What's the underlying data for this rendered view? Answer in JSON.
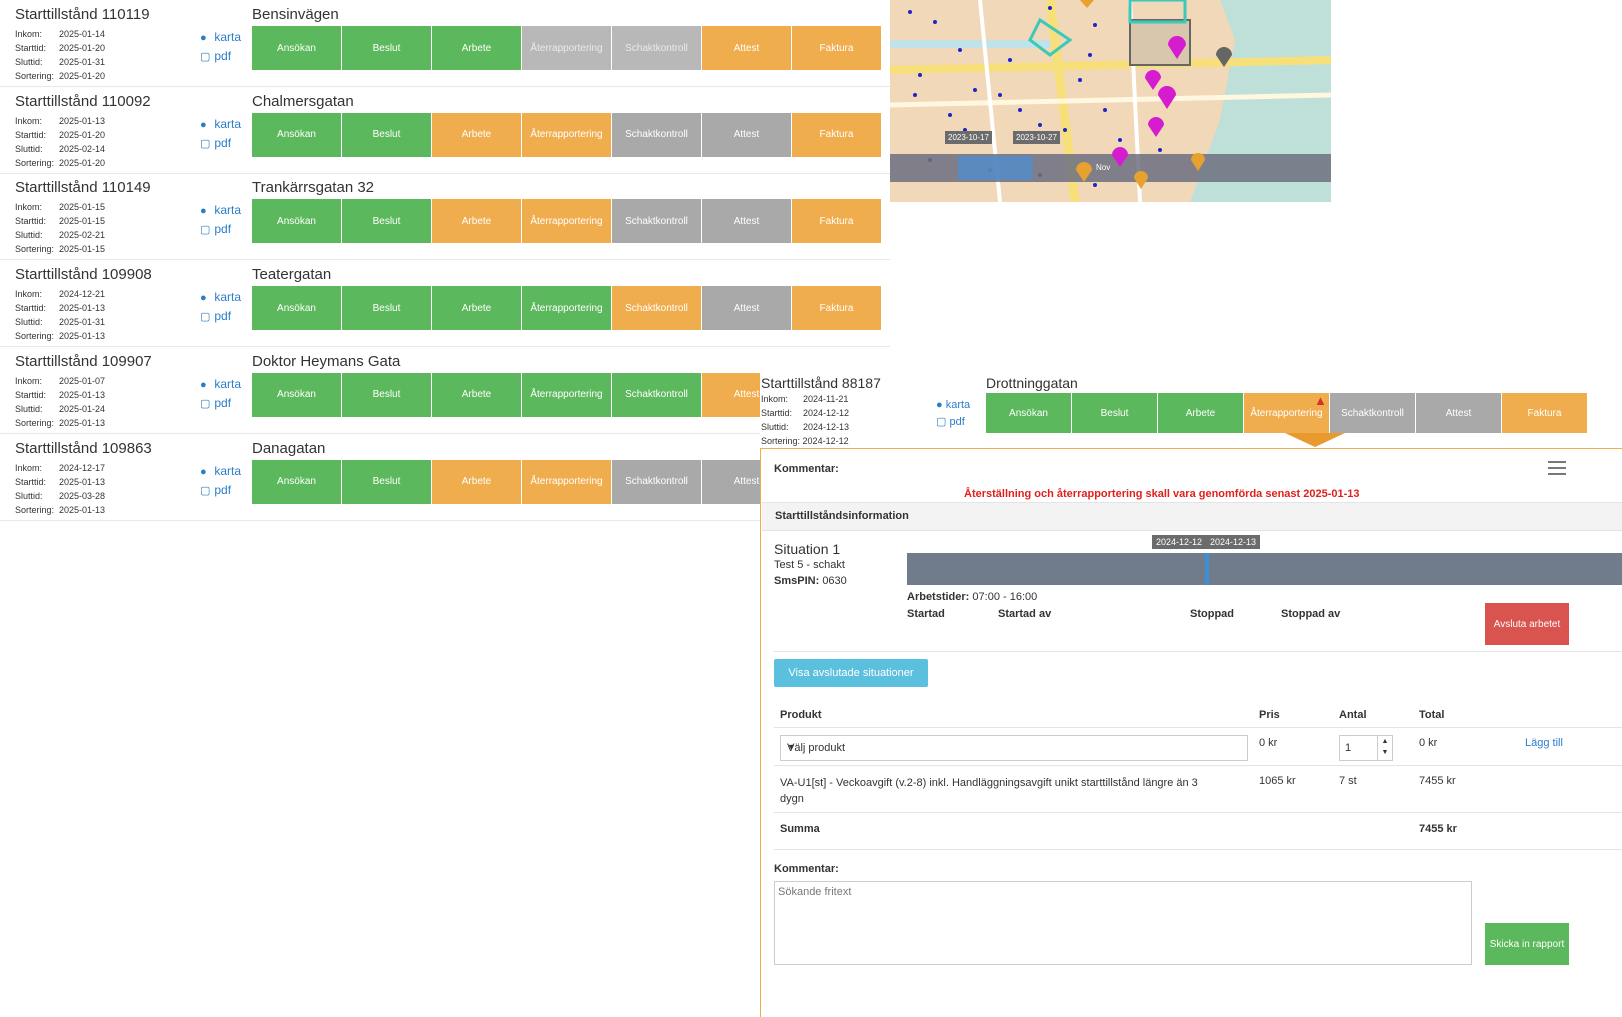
{
  "links": {
    "map": "karta",
    "pdf": "pdf"
  },
  "meta_keys": {
    "inkom": "Inkom:",
    "start": "Starttid:",
    "slut": "Sluttid:",
    "sort": "Sortering:"
  },
  "steps": [
    "Ansökan",
    "Beslut",
    "Arbete",
    "Återrapportering",
    "Schaktkontroll",
    "Attest",
    "Faktura"
  ],
  "rows": [
    {
      "title": "Starttillstånd 110119",
      "street": "Bensinvägen",
      "inkom": "2025-01-14",
      "start": "2025-01-20",
      "slut": "2025-01-31",
      "sort": "2025-01-20",
      "states": [
        "green",
        "green",
        "green",
        "lgray",
        "lgray",
        "orange",
        "orange"
      ]
    },
    {
      "title": "Starttillstånd 110092",
      "street": "Chalmersgatan",
      "inkom": "2025-01-13",
      "start": "2025-01-20",
      "slut": "2025-02-14",
      "sort": "2025-01-20",
      "states": [
        "green",
        "green",
        "orange",
        "orange",
        "gray",
        "gray",
        "orange"
      ]
    },
    {
      "title": "Starttillstånd 110149",
      "street": "Trankärrsgatan 32",
      "inkom": "2025-01-15",
      "start": "2025-01-15",
      "slut": "2025-02-21",
      "sort": "2025-01-15",
      "states": [
        "green",
        "green",
        "orange",
        "orange",
        "gray",
        "gray",
        "orange"
      ]
    },
    {
      "title": "Starttillstånd 109908",
      "street": "Teatergatan",
      "inkom": "2024-12-21",
      "start": "2025-01-13",
      "slut": "2025-01-31",
      "sort": "2025-01-13",
      "states": [
        "green",
        "green",
        "green",
        "green",
        "orange",
        "gray",
        "orange"
      ]
    },
    {
      "title": "Starttillstånd 109907",
      "street": "Doktor Heymans Gata",
      "inkom": "2025-01-07",
      "start": "2025-01-13",
      "slut": "2025-01-24",
      "sort": "2025-01-13",
      "states": [
        "green",
        "green",
        "green",
        "green",
        "green",
        "orange",
        "orange"
      ]
    },
    {
      "title": "Starttillstånd 109863",
      "street": "Danagatan",
      "inkom": "2024-12-17",
      "start": "2025-01-13",
      "slut": "2025-03-28",
      "sort": "2025-01-13",
      "states": [
        "green",
        "green",
        "orange",
        "orange",
        "gray",
        "gray",
        "orange"
      ]
    }
  ],
  "map": {
    "dates": [
      "2023-10-17",
      "2023-10-27"
    ],
    "month": "Nov"
  },
  "detail": {
    "title": "Starttillstånd 88187",
    "street": "Drottninggatan",
    "inkom": "2024-11-21",
    "start": "2024-12-12",
    "slut": "2024-12-13",
    "sort": "2024-12-12",
    "states": [
      "green",
      "green",
      "green",
      "orange",
      "gray",
      "gray",
      "orange"
    ],
    "comment_label": "Kommentar:",
    "deadline": "Återställning och återrapportering skall vara genomförda senast 2025-01-13",
    "info_header": "Starttillståndsinformation",
    "situation": {
      "title": "Situation 1",
      "desc": "Test 5 - schakt",
      "pin_label": "SmsPIN:",
      "pin": "0630"
    },
    "timeline_dates": [
      "2024-12-12",
      "2024-12-13"
    ],
    "work_label": "Arbetstider:",
    "work_hours": "07:00 - 16:00",
    "cols": [
      "Startad",
      "Startad av",
      "Stoppad",
      "Stoppad av"
    ],
    "end_button": "Avsluta arbetet",
    "show_closed": "Visa avslutade situationer",
    "table_headers": [
      "Produkt",
      "Pris",
      "Antal",
      "Total"
    ],
    "product_select": "Välj produkt",
    "new_price": "0 kr",
    "new_qty": "1",
    "new_total": "0 kr",
    "add": "Lägg till",
    "item": {
      "name_line1": "VA-U1[st] - Veckoavgift (v.2-8) inkl. Handläggningsavgift unikt starttillstånd längre än 3",
      "name_line2": "dygn",
      "price": "1065 kr",
      "qty": "7 st",
      "total": "7455 kr"
    },
    "sum_label": "Summa",
    "sum": "7455 kr",
    "comment2_label": "Kommentar:",
    "comment_placeholder": "Sökande fritext",
    "submit": "Skicka in rapport"
  }
}
